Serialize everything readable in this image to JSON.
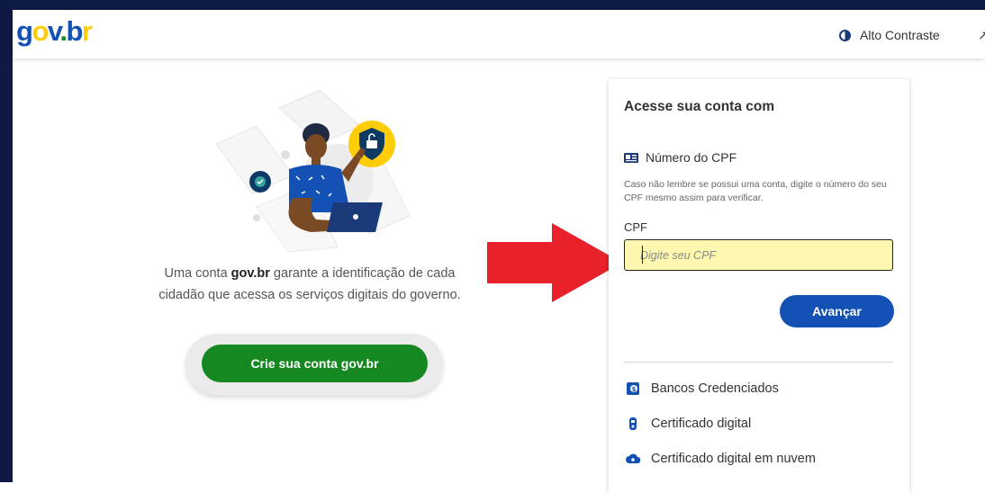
{
  "header": {
    "logo": {
      "g": "g",
      "o": "o",
      "v": "v",
      "dot": ".",
      "b": "b",
      "r": "r"
    },
    "contrast_label": "Alto Contraste",
    "extra_glyph": "↗"
  },
  "left": {
    "intro_prefix": "Uma conta ",
    "intro_brand": "gov.br",
    "intro_suffix": " garante a identificação de cada cidadão que acessa os serviços digitais do governo.",
    "create_button": "Crie sua conta gov.br"
  },
  "panel": {
    "title": "Acesse sua conta com",
    "cpf_option_label": "Número do CPF",
    "help_text": "Caso não lembre se possui uma conta, digite o número do seu CPF mesmo assim para verificar.",
    "cpf_field_label": "CPF",
    "cpf_placeholder": "Digite seu CPF",
    "cpf_value": "",
    "next_button": "Avançar",
    "alternatives": [
      {
        "label": "Bancos Credenciados",
        "icon": "bank-icon"
      },
      {
        "label": "Certificado digital",
        "icon": "usb-token-icon"
      },
      {
        "label": "Certificado digital em nuvem",
        "icon": "cloud-icon"
      }
    ]
  },
  "colors": {
    "primary_blue": "#1351b4",
    "green": "#168821",
    "yellow": "#ffcd07",
    "input_highlight": "#fdf7b0",
    "annotation_arrow": "#e8212a"
  }
}
